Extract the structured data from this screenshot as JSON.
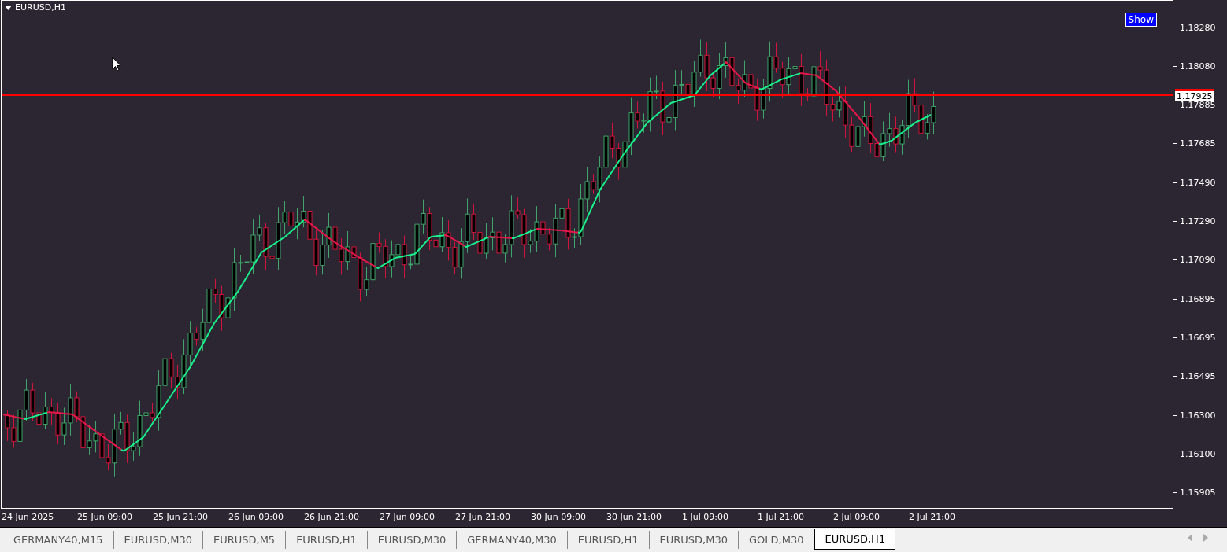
{
  "chart": {
    "title": "EURUSD,H1",
    "show_button": "Show",
    "current_price": "1.17925"
  },
  "price_axis": [
    "1.18280",
    "1.18080",
    "1.17885",
    "1.17685",
    "1.17490",
    "1.17290",
    "1.17090",
    "1.16895",
    "1.16695",
    "1.16495",
    "1.16300",
    "1.16100",
    "1.15905"
  ],
  "time_axis": [
    "24 Jun 2025",
    "25 Jun 09:00",
    "25 Jun 21:00",
    "26 Jun 09:00",
    "26 Jun 21:00",
    "27 Jun 09:00",
    "27 Jun 21:00",
    "30 Jun 09:00",
    "30 Jun 21:00",
    "1 Jul 09:00",
    "1 Jul 21:00",
    "2 Jul 09:00",
    "2 Jul 21:00"
  ],
  "tabs": [
    {
      "label": "GERMANY40,M15",
      "selected": false
    },
    {
      "label": "EURUSD,M30",
      "selected": false
    },
    {
      "label": "EURUSD,M5",
      "selected": false
    },
    {
      "label": "EURUSD,H1",
      "selected": false
    },
    {
      "label": "EURUSD,M30",
      "selected": false
    },
    {
      "label": "GERMANY40,M30",
      "selected": false
    },
    {
      "label": "EURUSD,H1",
      "selected": false
    },
    {
      "label": "EURUSD,M30",
      "selected": false
    },
    {
      "label": "GOLD,M30",
      "selected": false
    },
    {
      "label": "EURUSD,H1",
      "selected": true
    }
  ]
}
